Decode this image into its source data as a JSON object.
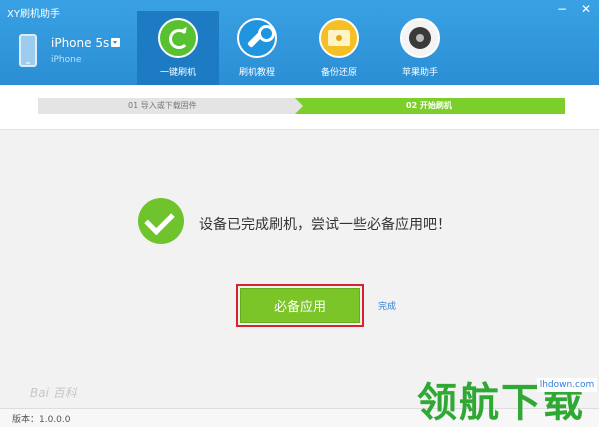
{
  "window": {
    "title": "XY刷机助手",
    "controls": [
      "−",
      "✕"
    ]
  },
  "device": {
    "name": "iPhone 5s",
    "model": "iPhone"
  },
  "tabs": [
    {
      "label": "一键刷机",
      "icon": "refresh-icon",
      "active": true
    },
    {
      "label": "刷机教程",
      "icon": "wrench-icon",
      "active": false
    },
    {
      "label": "备份还原",
      "icon": "backup-icon",
      "active": false
    },
    {
      "label": "苹果助手",
      "icon": "camera-icon",
      "active": false
    }
  ],
  "steps": {
    "step1": "01 导入或下载固件",
    "step2": "02 开始刷机"
  },
  "main": {
    "message": "设备已完成刷机，尝试一些必备应用吧！",
    "primary_button": "必备应用",
    "done_link": "完成"
  },
  "footer": {
    "version": "版本：1.0.0.0"
  },
  "watermarks": {
    "baidu": "Bai 百科",
    "site_logo": "领航下载",
    "site_url": "lhdown.com"
  },
  "colors": {
    "header": "#2b8ed4",
    "active_tab": "#1d7bc3",
    "accent_green": "#7bc528",
    "highlight_red": "#d6242a"
  }
}
